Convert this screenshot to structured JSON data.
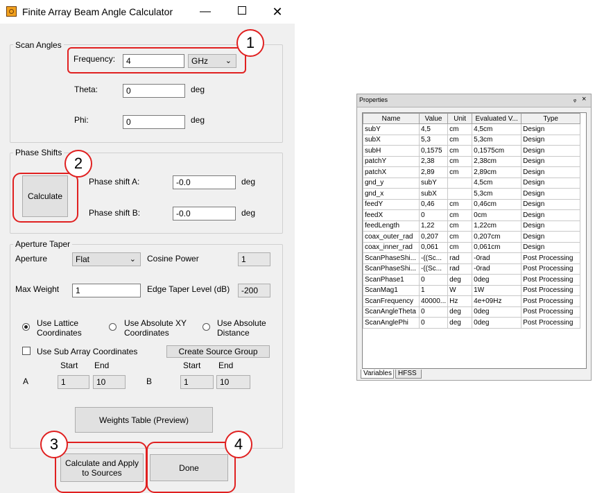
{
  "window": {
    "title": "Finite Array Beam Angle Calculator",
    "minimize": "—",
    "close": "✕"
  },
  "scan": {
    "group": "Scan Angles",
    "frequency_label": "Frequency:",
    "frequency_value": "4",
    "frequency_unit": "GHz",
    "theta_label": "Theta:",
    "theta_value": "0",
    "theta_unit": "deg",
    "phi_label": "Phi:",
    "phi_value": "0",
    "phi_unit": "deg"
  },
  "phase": {
    "group": "Phase Shifts",
    "calculate": "Calculate",
    "a_label": "Phase shift A:",
    "a_value": "-0.0",
    "a_unit": "deg",
    "b_label": "Phase shift B:",
    "b_value": "-0.0",
    "b_unit": "deg"
  },
  "taper": {
    "group": "Aperture Taper",
    "aperture_label": "Aperture",
    "aperture_value": "Flat",
    "cosine_label": "Cosine Power",
    "cosine_value": "1",
    "max_weight_label": "Max Weight",
    "max_weight_value": "1",
    "edge_label": "Edge Taper Level (dB)",
    "edge_value": "-200",
    "radio_lattice": "Use Lattice\nCoordinates",
    "radio_abs_xy": "Use Absolute XY\nCoordinates",
    "radio_abs_dist": "Use Absolute\nDistance",
    "sub_array": "Use Sub Array Coordinates",
    "create_group": "Create Source Group",
    "start": "Start",
    "end": "End",
    "a_label": "A",
    "a_start": "1",
    "a_end": "10",
    "b_label": "B",
    "b_start": "1",
    "b_end": "10",
    "weights_table": "Weights Table (Preview)"
  },
  "footer": {
    "apply": "Calculate and Apply\nto Sources",
    "done": "Done"
  },
  "callouts": [
    "1",
    "2",
    "3",
    "4"
  ],
  "properties": {
    "title": "Properties",
    "pin": "ᵩ",
    "close": "×",
    "headers": [
      "Name",
      "Value",
      "Unit",
      "Evaluated V...",
      "Type"
    ],
    "rows": [
      [
        "subY",
        "4,5",
        "cm",
        "4,5cm",
        "Design"
      ],
      [
        "subX",
        "5,3",
        "cm",
        "5,3cm",
        "Design"
      ],
      [
        "subH",
        "0,1575",
        "cm",
        "0,1575cm",
        "Design"
      ],
      [
        "patchY",
        "2,38",
        "cm",
        "2,38cm",
        "Design"
      ],
      [
        "patchX",
        "2,89",
        "cm",
        "2,89cm",
        "Design"
      ],
      [
        "gnd_y",
        "subY",
        "",
        "4,5cm",
        "Design"
      ],
      [
        "gnd_x",
        "subX",
        "",
        "5,3cm",
        "Design"
      ],
      [
        "feedY",
        "0,46",
        "cm",
        "0,46cm",
        "Design"
      ],
      [
        "feedX",
        "0",
        "cm",
        "0cm",
        "Design"
      ],
      [
        "feedLength",
        "1,22",
        "cm",
        "1,22cm",
        "Design"
      ],
      [
        "coax_outer_rad",
        "0,207",
        "cm",
        "0,207cm",
        "Design"
      ],
      [
        "coax_inner_rad",
        "0,061",
        "cm",
        "0,061cm",
        "Design"
      ],
      [
        "ScanPhaseShi...",
        "-((Sc...",
        "rad",
        "-0rad",
        "Post Processing"
      ],
      [
        "ScanPhaseShi...",
        "-((Sc...",
        "rad",
        "-0rad",
        "Post Processing"
      ],
      [
        "ScanPhase1",
        "0",
        "deg",
        "0deg",
        "Post Processing"
      ],
      [
        "ScanMag1",
        "1",
        "W",
        "1W",
        "Post Processing"
      ],
      [
        "ScanFrequency",
        "40000...",
        "Hz",
        "4e+09Hz",
        "Post Processing"
      ],
      [
        "ScanAngleTheta",
        "0",
        "deg",
        "0deg",
        "Post Processing"
      ],
      [
        "ScanAnglePhi",
        "0",
        "deg",
        "0deg",
        "Post Processing"
      ]
    ],
    "tabs": [
      "Variables",
      "HFSS"
    ]
  }
}
